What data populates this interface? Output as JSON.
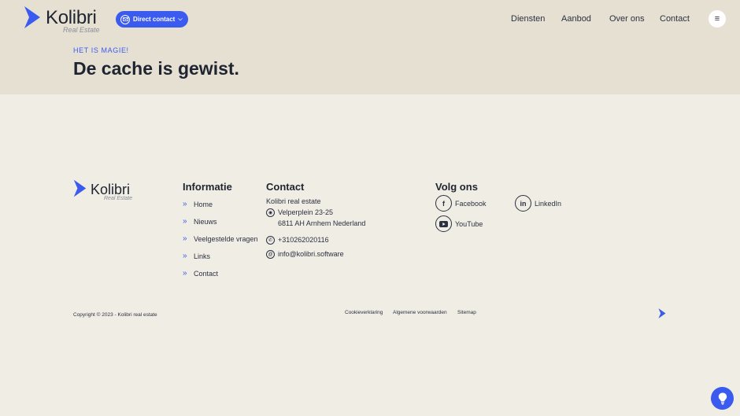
{
  "brand": {
    "name": "Kolibri",
    "tagline": "Real Estate",
    "accent": "#3a5af0"
  },
  "header": {
    "direct_contact": "Direct contact",
    "nav": [
      {
        "label": "Diensten"
      },
      {
        "label": "Aanbod"
      },
      {
        "label": "Over ons"
      },
      {
        "label": "Contact"
      }
    ],
    "menu_icon": "hamburger-icon"
  },
  "hero": {
    "eyebrow": "HET IS MAGIE!",
    "title": "De cache is gewist."
  },
  "footer": {
    "info": {
      "title": "Informatie",
      "links": [
        "Home",
        "Nieuws",
        "Veelgestelde vragen",
        "Links",
        "Contact"
      ]
    },
    "contact": {
      "title": "Contact",
      "company": "Kolibri real estate",
      "address_line1": "Velperplein 23-25",
      "address_line2": "6811 AH Arnhem Nederland",
      "phone": "+310262020116",
      "email": "info@kolibri.software"
    },
    "social": {
      "title": "Volg ons",
      "items": [
        {
          "label": "Facebook",
          "icon": "facebook-icon"
        },
        {
          "label": "LinkedIn",
          "icon": "linkedin-icon"
        },
        {
          "label": "YouTube",
          "icon": "youtube-icon"
        }
      ]
    },
    "copyright": "Copyright © 2023 - Kolibri real estate",
    "legal": [
      "Cookieverklaring",
      "Algemene voorwaarden",
      "Sitemap"
    ]
  }
}
